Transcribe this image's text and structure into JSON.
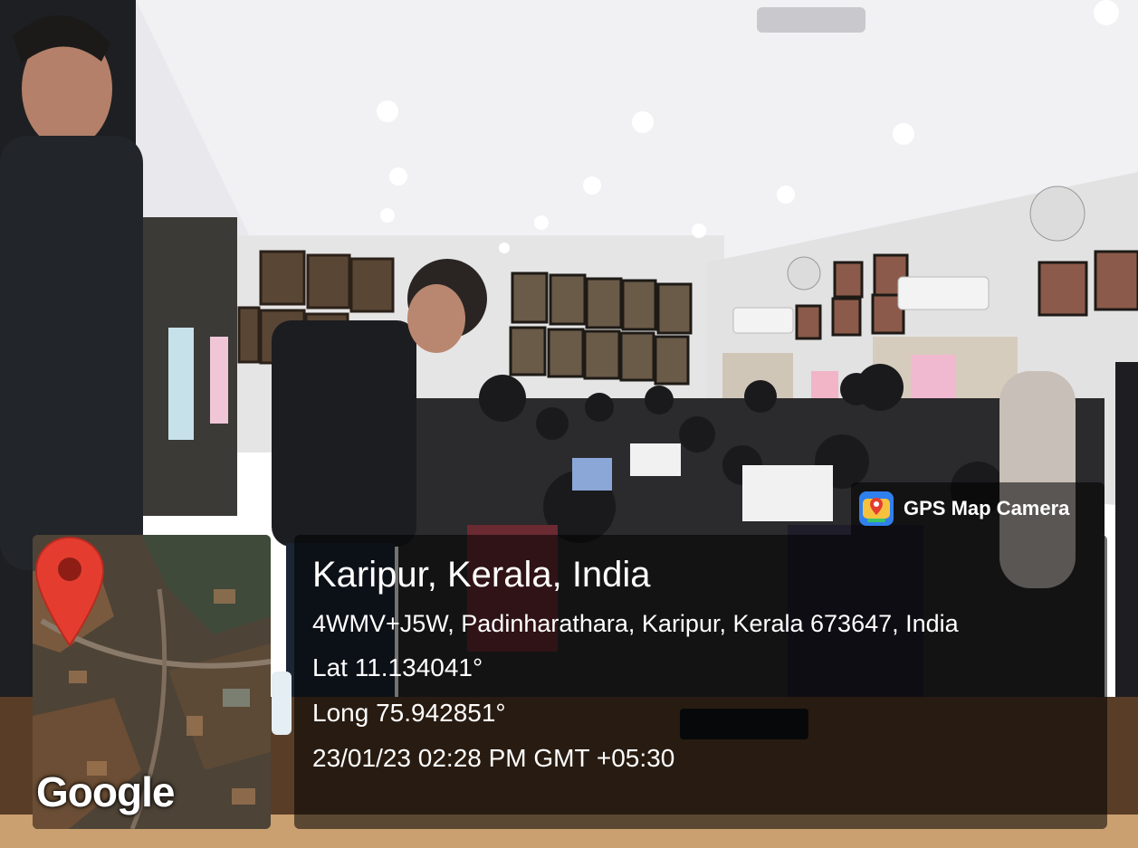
{
  "camera_tag": {
    "label": "GPS Map Camera",
    "icon": "map-pin-camera-icon"
  },
  "map": {
    "brand": "Google",
    "pin_icon": "location-pin-icon",
    "pin_color": "#e43d30"
  },
  "location": {
    "title": "Karipur, Kerala, India",
    "address": "4WMV+J5W, Padinharathara, Karipur, Kerala 673647, India",
    "latitude": "Lat 11.134041°",
    "longitude": "Long 75.942851°",
    "timestamp": "23/01/23 02:28 PM GMT +05:30"
  },
  "colors": {
    "overlay": "rgba(0,0,0,0.55)",
    "text": "#ffffff"
  }
}
